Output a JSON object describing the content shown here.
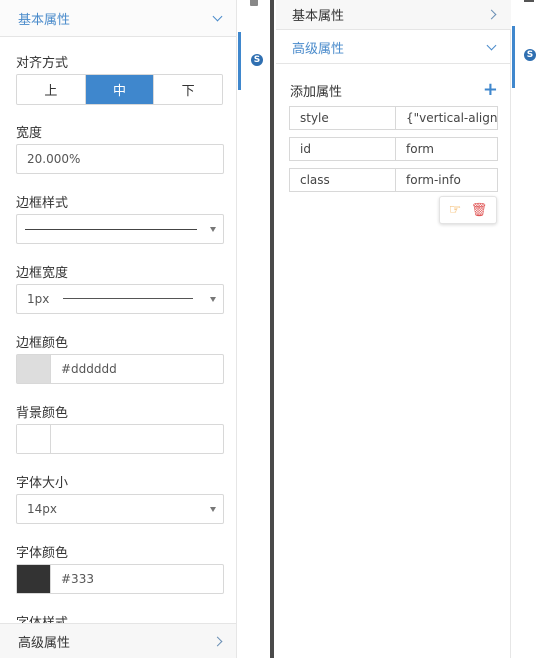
{
  "left_panel": {
    "header_basic": "基本属性",
    "alignment": {
      "label": "对齐方式",
      "options": [
        "上",
        "中",
        "下"
      ],
      "selected": "中"
    },
    "width": {
      "label": "宽度",
      "value": "20.000%"
    },
    "border_style": {
      "label": "边框样式"
    },
    "border_width": {
      "label": "边框宽度",
      "value": "1px"
    },
    "border_color": {
      "label": "边框颜色",
      "value": "#dddddd",
      "swatch": "#dddddd"
    },
    "bg_color": {
      "label": "背景颜色",
      "value": ""
    },
    "font_size": {
      "label": "字体大小",
      "value": "14px"
    },
    "font_color": {
      "label": "字体颜色",
      "value": "#333",
      "swatch": "#333333"
    },
    "font_style": {
      "label": "字体样式"
    },
    "header_advanced": "高级属性"
  },
  "right_panel": {
    "header_basic": "基本属性",
    "header_advanced": "高级属性",
    "add_label": "添加属性",
    "add_icon": "+",
    "attributes": [
      {
        "key": "style",
        "value": "{\"vertical-align"
      },
      {
        "key": "id",
        "value": "form"
      },
      {
        "key": "class",
        "value": "form-info"
      }
    ]
  },
  "colors": {
    "accent": "#3f87cd",
    "header_text": "#4a8bcb"
  }
}
